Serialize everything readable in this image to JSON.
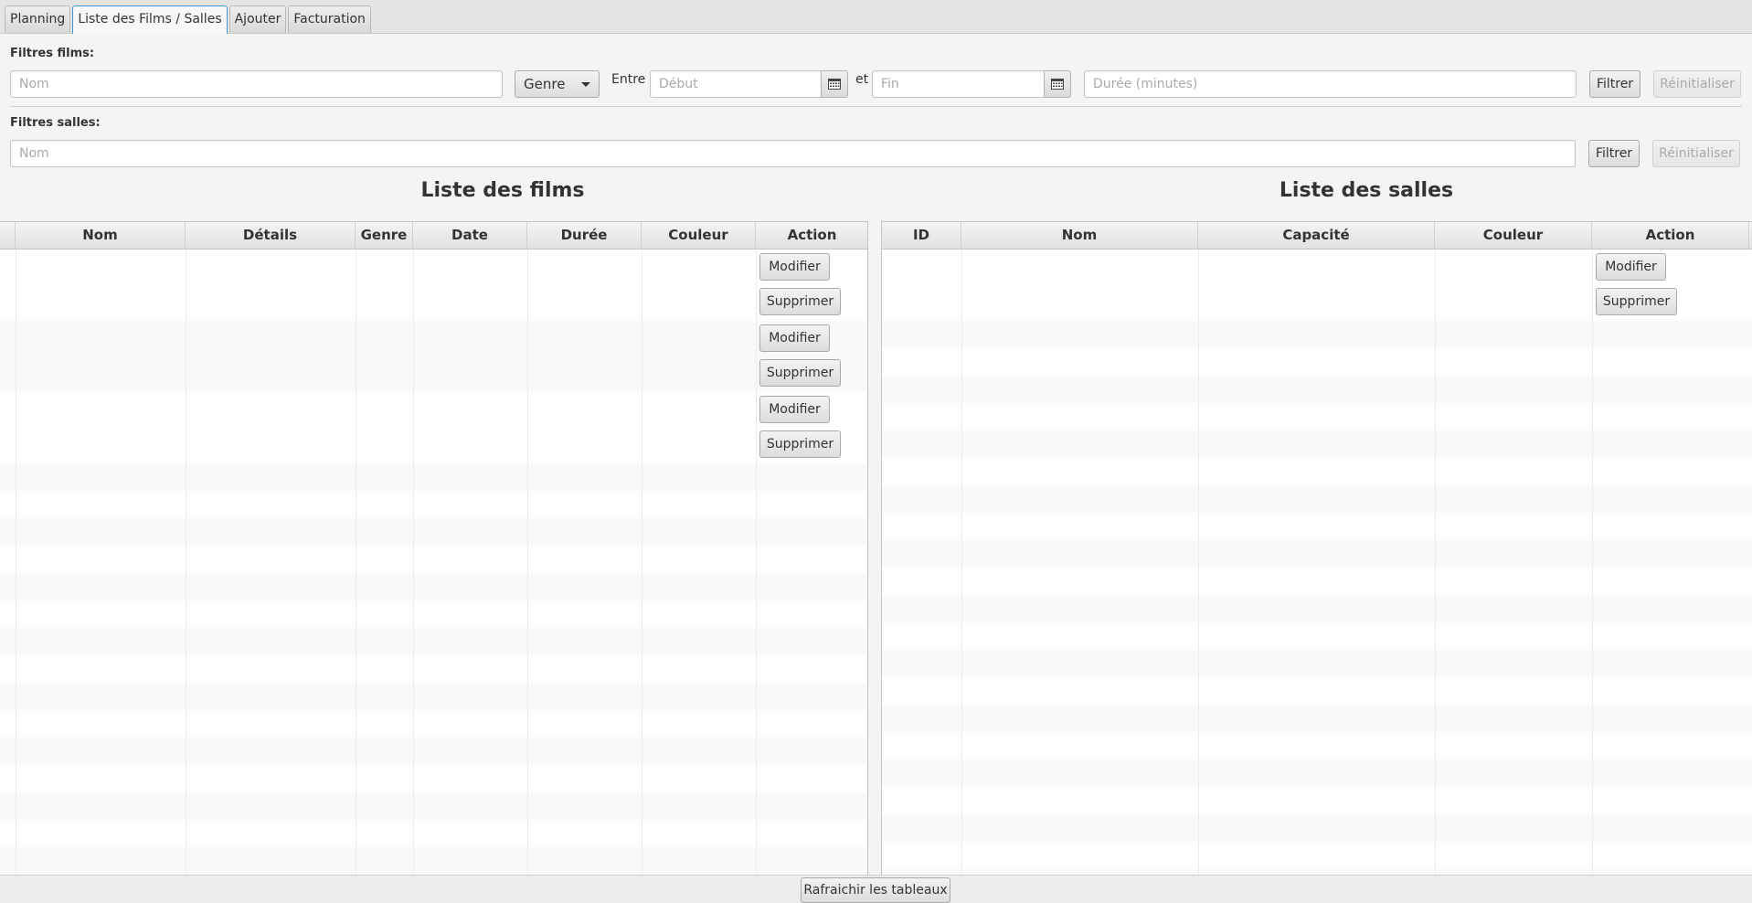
{
  "tabs": [
    "Planning",
    "Liste des Films / Salles",
    "Ajouter",
    "Facturation"
  ],
  "active_tab": 1,
  "film_filters": {
    "label": "Filtres films:",
    "name_placeholder": "Nom",
    "genre_label": "Genre",
    "between_label": "Entre",
    "start_placeholder": "Début",
    "and_label": "et",
    "end_placeholder": "Fin",
    "duration_placeholder": "Durée (minutes)",
    "filter_button": "Filtrer",
    "reset_button": "Réinitialiser"
  },
  "room_filters": {
    "label": "Filtres salles:",
    "name_placeholder": "Nom",
    "filter_button": "Filtrer",
    "reset_button": "Réinitialiser"
  },
  "films_table": {
    "title": "Liste des films",
    "columns": [
      "",
      "Nom",
      "Détails",
      "Genre",
      "Date",
      "Durée",
      "Couleur",
      "Action"
    ],
    "modify_label": "Modifier",
    "delete_label": "Supprimer",
    "action_rows": 3
  },
  "rooms_table": {
    "title": "Liste des salles",
    "columns": [
      "ID",
      "Nom",
      "Capacité",
      "Couleur",
      "Action"
    ],
    "modify_label": "Modifier",
    "delete_label": "Supprimer",
    "action_rows": 1
  },
  "refresh_button": "Rafraichir les tableaux"
}
